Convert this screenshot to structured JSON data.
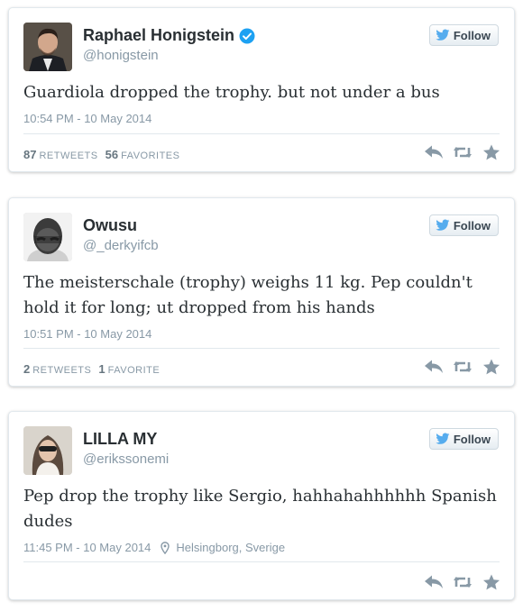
{
  "tweets": [
    {
      "name": "Raphael Honigstein",
      "verified": true,
      "handle": "@honigstein",
      "follow_label": "Follow",
      "text": "Guardiola dropped the trophy. but not under a bus",
      "time": "10:54 PM - 10 May 2014",
      "retweets_count": "87",
      "retweets_label": "RETWEETS",
      "favorites_count": "56",
      "favorites_label": "FAVORITES"
    },
    {
      "name": "Owusu",
      "verified": false,
      "handle": "@_derkyifcb",
      "follow_label": "Follow",
      "text": "The meisterschale (trophy) weighs 11 kg. Pep couldn't hold it for long; ut dropped from his hands",
      "time": "10:51 PM - 10 May 2014",
      "retweets_count": "2",
      "retweets_label": "RETWEETS",
      "favorites_count": "1",
      "favorites_label": "FAVORITE"
    },
    {
      "name": "LILLA MY",
      "verified": false,
      "handle": "@erikssonemi",
      "follow_label": "Follow",
      "text": "Pep drop the trophy like Sergio, hahhahahhhhhh Spanish dudes",
      "time": "11:45 PM - 10 May 2014",
      "location": "Helsingborg, Sverige"
    }
  ],
  "colors": {
    "twitter_blue": "#55acee",
    "verified_blue": "#1da1f2",
    "muted_text": "#8899a6",
    "action_icon": "#8899a6"
  },
  "icons": {
    "verified": "verified-badge-icon",
    "follow": "twitter-bird-icon",
    "location": "location-pin-icon",
    "reply": "reply-icon",
    "retweet": "retweet-icon",
    "favorite": "star-icon"
  }
}
